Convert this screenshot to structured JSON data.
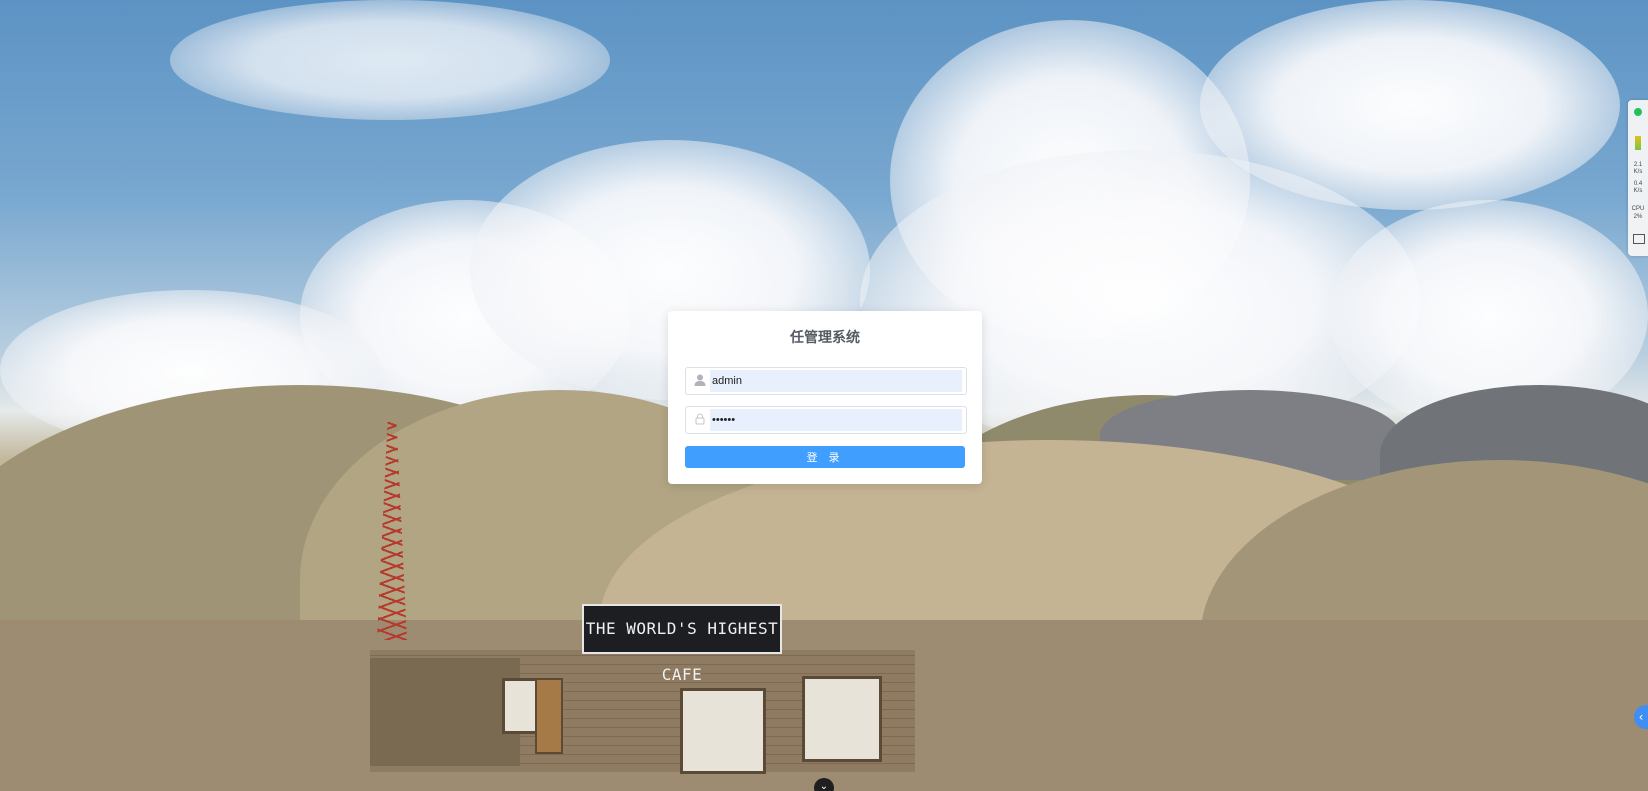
{
  "login": {
    "title": "任管理系统",
    "username_value": "admin",
    "password_value": "••••••",
    "submit_label": "登 录"
  },
  "background": {
    "cafe_sign": "THE WORLD'S HIGHEST CAFE"
  },
  "monitor": {
    "net_down": "2.1",
    "net_down_unit": "K/s",
    "net_up": "0.4",
    "net_up_unit": "K/s",
    "cpu_label": "CPU",
    "cpu_value": "2%"
  },
  "icons": {
    "user": "user-icon",
    "lock": "lock-icon",
    "collapse": "chevron-left-icon",
    "expand": "chevron-down-icon"
  },
  "colors": {
    "primary": "#409eff",
    "card_bg": "#ffffff",
    "input_autofill": "#e8f0fe"
  }
}
